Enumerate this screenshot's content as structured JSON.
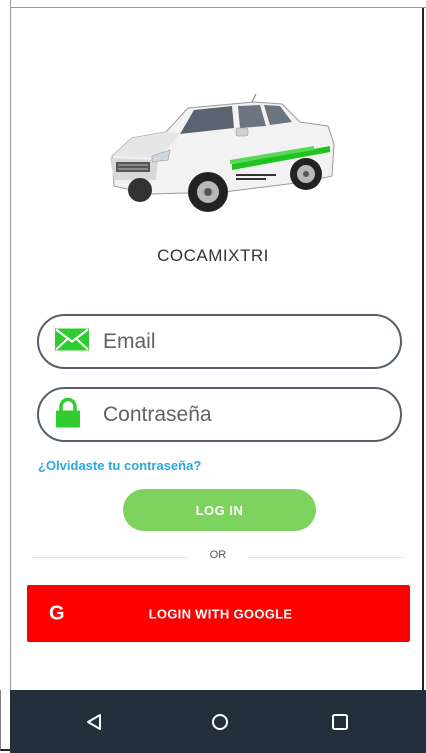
{
  "app": {
    "name": "COCAMIXTRI"
  },
  "form": {
    "email_placeholder": "Email",
    "password_placeholder": "Contraseña",
    "forgot_label": "¿Olvidaste tu contraseña?",
    "login_label": "LOG IN",
    "or_label": "OR",
    "google_label": "LOGIN WITH GOOGLE",
    "google_icon_glyph": "G"
  },
  "icons": {
    "email": "envelope-icon",
    "password": "lock-icon",
    "truck": "pickup-truck-image",
    "back": "back-triangle-icon",
    "home": "home-circle-icon",
    "recent": "recent-apps-square-icon"
  },
  "colors": {
    "field_border": "#55606b",
    "icon_green": "#2ecc2e",
    "link": "#2aa8e0",
    "login_button": "#7ed35f",
    "google_button": "#ff0000",
    "navbar": "#232f3a"
  }
}
